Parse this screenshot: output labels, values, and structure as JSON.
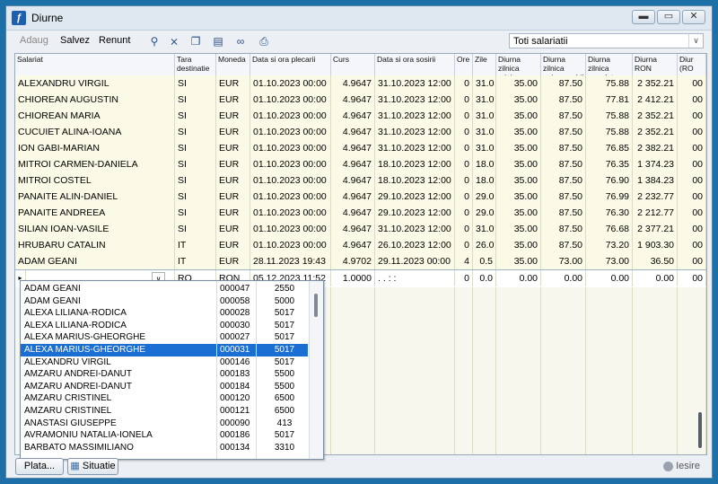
{
  "window": {
    "title": "Diurne"
  },
  "toolbar": {
    "adaug": "Adaug",
    "salvez": "Salvez",
    "renunt": "Renunt",
    "icons": [
      "binoculars-icon",
      "filter-clear-icon",
      "copy-icon",
      "paste-icon",
      "link-icon",
      "print-icon"
    ]
  },
  "filter": {
    "value": "Toti salariatii"
  },
  "columns": [
    "Salariat",
    "Tara destinatie",
    "Moneda",
    "Data si ora plecarii",
    "Curs",
    "Data si ora sosirii",
    "Ore",
    "Zile",
    "Diurna zilnica minima",
    "Diurna zilnica neimpozabila",
    "Diurna zilnica acordata RON",
    "Diurna RON",
    "Diur (RO"
  ],
  "rows": [
    [
      "ALEXANDRU VIRGIL",
      "SI",
      "EUR",
      "01.10.2023 00:00",
      "4.9647",
      "31.10.2023 12:00",
      "0",
      "31.0",
      "35.00",
      "87.50",
      "75.88",
      "2 352.21",
      "00"
    ],
    [
      "CHIOREAN AUGUSTIN",
      "SI",
      "EUR",
      "01.10.2023 00:00",
      "4.9647",
      "31.10.2023 12:00",
      "0",
      "31.0",
      "35.00",
      "87.50",
      "77.81",
      "2 412.21",
      "00"
    ],
    [
      "CHIOREAN MARIA",
      "SI",
      "EUR",
      "01.10.2023 00:00",
      "4.9647",
      "31.10.2023 12:00",
      "0",
      "31.0",
      "35.00",
      "87.50",
      "75.88",
      "2 352.21",
      "00"
    ],
    [
      "CUCUIET ALINA-IOANA",
      "SI",
      "EUR",
      "01.10.2023 00:00",
      "4.9647",
      "31.10.2023 12:00",
      "0",
      "31.0",
      "35.00",
      "87.50",
      "75.88",
      "2 352.21",
      "00"
    ],
    [
      "ION GABI-MARIAN",
      "SI",
      "EUR",
      "01.10.2023 00:00",
      "4.9647",
      "31.10.2023 12:00",
      "0",
      "31.0",
      "35.00",
      "87.50",
      "76.85",
      "2 382.21",
      "00"
    ],
    [
      "MITROI CARMEN-DANIELA",
      "SI",
      "EUR",
      "01.10.2023 00:00",
      "4.9647",
      "18.10.2023 12:00",
      "0",
      "18.0",
      "35.00",
      "87.50",
      "76.35",
      "1 374.23",
      "00"
    ],
    [
      "MITROI COSTEL",
      "SI",
      "EUR",
      "01.10.2023 00:00",
      "4.9647",
      "18.10.2023 12:00",
      "0",
      "18.0",
      "35.00",
      "87.50",
      "76.90",
      "1 384.23",
      "00"
    ],
    [
      "PANAITE ALIN-DANIEL",
      "SI",
      "EUR",
      "01.10.2023 00:00",
      "4.9647",
      "29.10.2023 12:00",
      "0",
      "29.0",
      "35.00",
      "87.50",
      "76.99",
      "2 232.77",
      "00"
    ],
    [
      "PANAITE ANDREEA",
      "SI",
      "EUR",
      "01.10.2023 00:00",
      "4.9647",
      "29.10.2023 12:00",
      "0",
      "29.0",
      "35.00",
      "87.50",
      "76.30",
      "2 212.77",
      "00"
    ],
    [
      "SILIAN IOAN-VASILE",
      "SI",
      "EUR",
      "01.10.2023 00:00",
      "4.9647",
      "31.10.2023 12:00",
      "0",
      "31.0",
      "35.00",
      "87.50",
      "76.68",
      "2 377.21",
      "00"
    ],
    [
      "HRUBARU CATALIN",
      "IT",
      "EUR",
      "01.10.2023 00:00",
      "4.9647",
      "26.10.2023 12:00",
      "0",
      "26.0",
      "35.00",
      "87.50",
      "73.20",
      "1 903.30",
      "00"
    ],
    [
      "ADAM GEANI",
      "IT",
      "EUR",
      "28.11.2023 19:43",
      "4.9702",
      "29.11.2023 00:00",
      "4",
      "0.5",
      "35.00",
      "73.00",
      "73.00",
      "36.50",
      "00"
    ]
  ],
  "newrow": [
    "",
    "RO",
    "RON",
    "05.12.2023 11:52",
    "1.0000",
    ". .   : :",
    "0",
    "0.0",
    "0.00",
    "0.00",
    "0.00",
    "0.00",
    "00"
  ],
  "dropdown": [
    [
      "ADAM GEANI",
      "000047",
      "2550"
    ],
    [
      "ADAM GEANI",
      "000058",
      "5000"
    ],
    [
      "ALEXA LILIANA-RODICA",
      "000028",
      "5017"
    ],
    [
      "ALEXA LILIANA-RODICA",
      "000030",
      "5017"
    ],
    [
      "ALEXA MARIUS-GHEORGHE",
      "000027",
      "5017"
    ],
    [
      "ALEXA MARIUS-GHEORGHE",
      "000031",
      "5017"
    ],
    [
      "ALEXANDRU VIRGIL",
      "000146",
      "5017"
    ],
    [
      "AMZARU ANDREI-DANUT",
      "000183",
      "5500"
    ],
    [
      "AMZARU ANDREI-DANUT",
      "000184",
      "5500"
    ],
    [
      "AMZARU CRISTINEL",
      "000120",
      "6500"
    ],
    [
      "AMZARU CRISTINEL",
      "000121",
      "6500"
    ],
    [
      "ANASTASI GIUSEPPE",
      "000090",
      "413"
    ],
    [
      "AVRAMONIU NATALIA-IONELA",
      "000186",
      "5017"
    ],
    [
      "BARBATO MASSIMILIANO",
      "000134",
      "3310"
    ]
  ],
  "bottom": {
    "plata": "Plata...",
    "situatie": "Situatie",
    "iesire": "Iesire"
  }
}
